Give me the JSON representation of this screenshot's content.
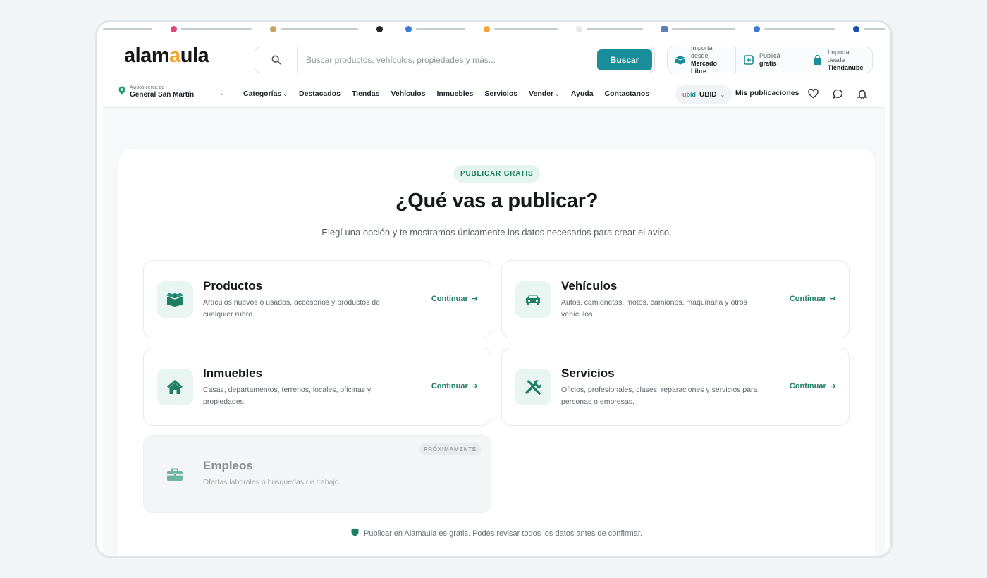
{
  "bookmarks": [
    "",
    "",
    "",
    "",
    "",
    "",
    "",
    "",
    "",
    "",
    "",
    ""
  ],
  "header": {
    "logo_part1": "alam",
    "logo_part2": "a",
    "logo_part3": "ula",
    "search": {
      "placeholder": "Buscar productos, vehículos, propiedades y más...",
      "button": "Buscar"
    },
    "imports": [
      {
        "line1": "Importa desde",
        "line2": "Mercado Libre"
      },
      {
        "line1": "Publicá",
        "line2": "gratis"
      },
      {
        "line1": "Importa desde",
        "line2": "Tiendanube"
      }
    ]
  },
  "nav": {
    "location_prefix": "Avisos cerca de",
    "location": "General San Martín",
    "items": [
      "Categorías",
      "Destacados",
      "Tiendas",
      "Vehículos",
      "Inmuebles",
      "Servicios",
      "Vender",
      "Ayuda",
      "Contactanos"
    ],
    "ubid_logo_a": "u",
    "ubid_logo_b": "bid",
    "ubid": "UBID",
    "mis_publicaciones": "Mis publicaciones"
  },
  "main": {
    "badge": "PUBLICAR GRATIS",
    "title": "¿Qué vas a publicar?",
    "subtitle": "Elegí una opción y te mostramos únicamente los datos necesarios para crear el aviso.",
    "options": [
      {
        "title": "Productos",
        "desc": "Artículos nuevos o usados, accesorios y productos de cualquier rubro.",
        "cta": "Continuar",
        "icon": "box-icon"
      },
      {
        "title": "Vehículos",
        "desc": "Autos, camionetas, motos, camiones, maquinaria y otros vehículos.",
        "cta": "Continuar",
        "icon": "car-icon"
      },
      {
        "title": "Inmuebles",
        "desc": "Casas, departamentos, terrenos, locales, oficinas y propiedades.",
        "cta": "Continuar",
        "icon": "house-icon"
      },
      {
        "title": "Servicios",
        "desc": "Oficios, profesionales, clases, reparaciones y servicios para personas o empresas.",
        "cta": "Continuar",
        "icon": "tools-icon"
      },
      {
        "title": "Empleos",
        "desc": "Ofertas laborales o búsquedas de trabajo.",
        "badge": "PRÓXIMAMENTE",
        "icon": "briefcase-icon"
      }
    ],
    "footnote": "Publicar en Alamaula es gratis. Podés revisar todos los datos antes de confirmar."
  },
  "colors": {
    "accent": "#1a8d9a",
    "green": "#1f7d63",
    "logo_orange": "#f4a321"
  }
}
